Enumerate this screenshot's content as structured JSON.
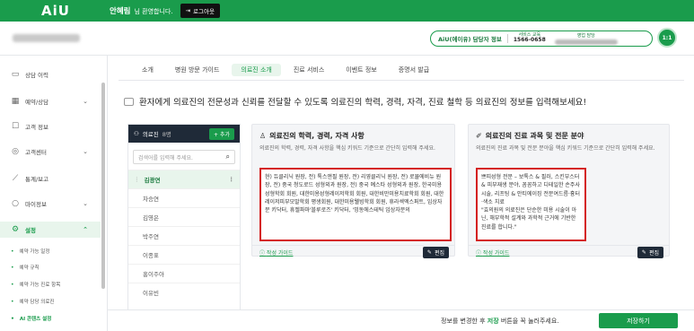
{
  "topbar": {
    "logo": "AiU",
    "user_name": "안혜림",
    "greeting": "님 환영합니다.",
    "logout_label": "로그아웃"
  },
  "header": {
    "aiu_label": "AiU(에이유) 담당자 정보",
    "service_label": "서비스 교육",
    "service_phone": "1566-0658",
    "manager_label": "영업 담당"
  },
  "sidebar": {
    "items": [
      {
        "label": "상담 이력",
        "icon": "chat-icon"
      },
      {
        "label": "예약/상담",
        "icon": "calendar-icon"
      },
      {
        "label": "고객 정보",
        "icon": "person-icon"
      },
      {
        "label": "고객센터",
        "icon": "headset-icon"
      },
      {
        "label": "통계/보고",
        "icon": "chart-icon"
      },
      {
        "label": "마이정보",
        "icon": "person-circle-icon"
      },
      {
        "label": "설정",
        "icon": "gear-icon"
      }
    ],
    "sub_items": [
      {
        "label": "예약 가능 일정"
      },
      {
        "label": "예약 규칙"
      },
      {
        "label": "예약 가능 진료 항목"
      },
      {
        "label": "예약 담당 의료진"
      },
      {
        "label": "AI 콘텐츠 설정"
      }
    ]
  },
  "tabs": [
    "소개",
    "병원 방문 가이드",
    "의료진 소개",
    "진료 서비스",
    "이벤트 정보",
    "증명서 발급"
  ],
  "intro": "환자에게 의료진의 전문성과 신뢰를 전달할 수 있도록 의료진의 학력, 경력, 자격, 진료 철학 등 의료진의 정보를 입력해보세요!",
  "doctors": {
    "title": "의료진",
    "count": "8명",
    "add_label": "+ 추가",
    "search_placeholder": "검색어를 입력해 주세요.",
    "list": [
      "김광연",
      "차승연",
      "김영은",
      "박주연",
      "이종표",
      "홍이주아",
      "이유빈"
    ]
  },
  "card1": {
    "title": "의료진의 학력, 경력, 자격 사항",
    "desc": "의료진의 학력, 경력, 자격 사항을 핵심 키워드 기준으로 간단히 입력해 주세요.",
    "text": "현) 듀클리닉 원장, 전) 톡스앤필 원장, 전) 리영클리닉 원장, 전) 로뮬에비뉴 원장, 전) 중국 청도로드 성형외과 원장, 전) 중국 예스타 성형외과 원장, 한국미용성형학회 회원, 대한미용성형레이저학회 회원, 대한비만미용치료학회 회원, 대한레이저피부모발학회 평생회원, 대한미용웰빙학회 회원, 휴라섹엑스퍼트, 임상자문 키닥터, 휴젤파마'블루로즈' 키닥터, '밍동에스테틱 임상자문의",
    "guide_label": "작성 가이드",
    "edit_label": "편집"
  },
  "card2": {
    "title": "의료진의 진료 과목 및 전문 분야",
    "desc": "의료진의 진료 과목 및 전문 분야을 핵심 키워드 기준으로 간단히 입력해 주세요.",
    "text": "쁘띠성형 전문 – 보톡스 & 필러, 스킨부스터 & 피부재생 분야, 꼼꼼하고 디테일한 손주사 시술, 리프팅 & 안티에이징 전문여드름·흉터·색소 치료\n\"효의원의 의료진은 단순한 미용 시술이 아닌, 해부학적 설계와 과학적 근거에 기반한 진료를 합니다.\"",
    "guide_label": "작성 가이드",
    "edit_label": "편집"
  },
  "footer": {
    "msg_prefix": "정보를 변경한 후 ",
    "msg_highlight": "저장",
    "msg_suffix": " 버튼을 꼭 눌러주세요.",
    "save_label": "저장하기"
  },
  "colors": {
    "brand": "#1a9c4c",
    "dark": "#1f2a38",
    "highlight_border": "#d42020"
  }
}
